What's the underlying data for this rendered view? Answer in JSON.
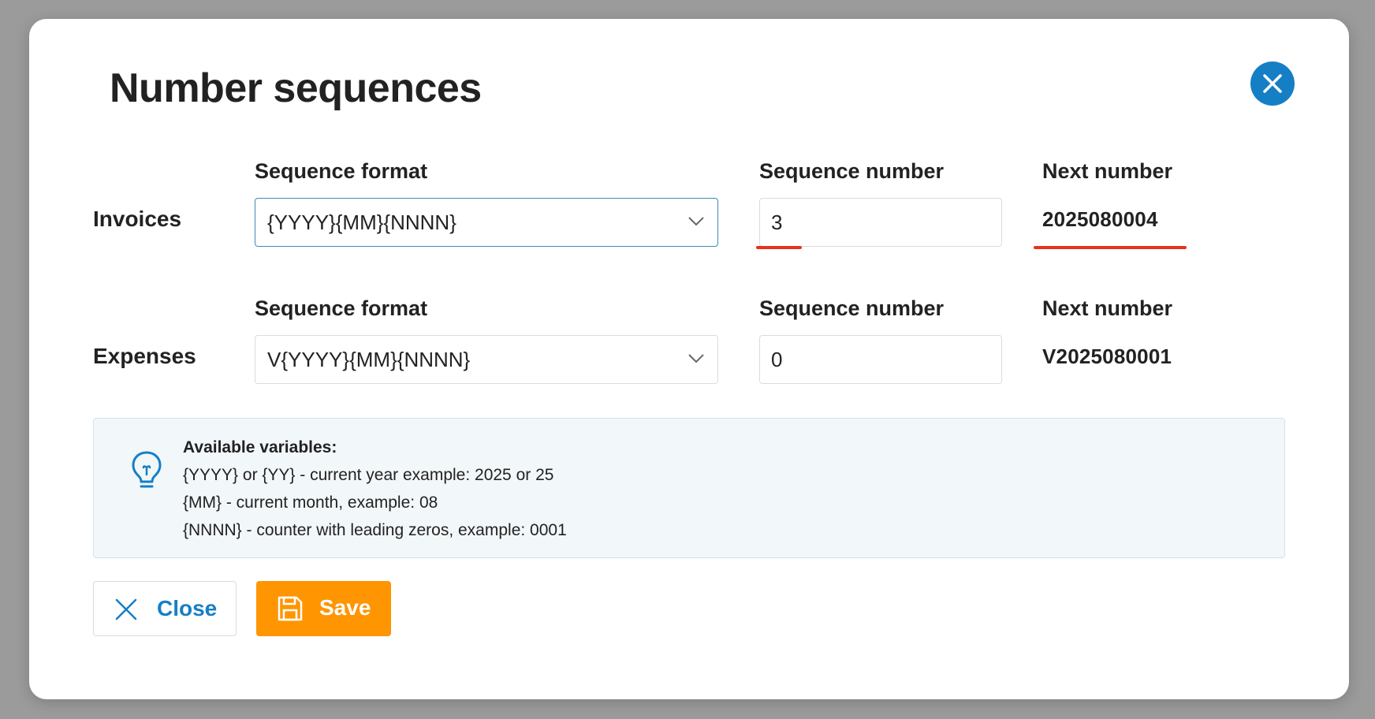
{
  "modal": {
    "title": "Number sequences"
  },
  "columns": {
    "sequence_format": "Sequence format",
    "sequence_number": "Sequence number",
    "next_number": "Next number"
  },
  "rows": [
    {
      "label": "Invoices",
      "sequence_format": "{YYYY}{MM}{NNNN}",
      "sequence_number": "3",
      "next_number": "2025080004"
    },
    {
      "label": "Expenses",
      "sequence_format": "V{YYYY}{MM}{NNNN}",
      "sequence_number": "0",
      "next_number": "V2025080001"
    }
  ],
  "info": {
    "icon": "lightbulb-icon",
    "heading": "Available variables:",
    "lines": [
      "{YYYY} or {YY} - current year example: 2025 or 25",
      "{MM} - current month, example: 08",
      "{NNNN} - counter with leading zeros, example: 0001"
    ]
  },
  "buttons": {
    "close_label": "Close",
    "save_label": "Save"
  },
  "colors": {
    "accent_blue": "#157fc5",
    "save_orange": "#ff9500",
    "annotation_red": "#e8321e",
    "info_background": "#f2f7f9"
  }
}
